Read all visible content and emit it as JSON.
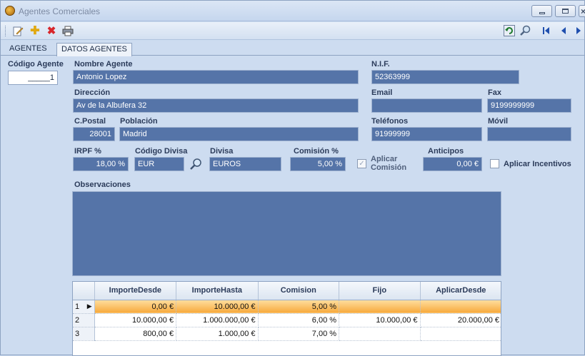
{
  "window": {
    "title": "Agentes Comerciales"
  },
  "tabs": [
    {
      "label": "AGENTES"
    },
    {
      "label": "DATOS AGENTES"
    }
  ],
  "form": {
    "codigo_agente": {
      "label": "Código Agente",
      "value": "_____1"
    },
    "nombre_agente": {
      "label": "Nombre Agente",
      "value": "Antonio Lopez"
    },
    "nif": {
      "label": "N.I.F.",
      "value": "52363999"
    },
    "direccion": {
      "label": "Dirección",
      "value": "Av de la Albufera 32"
    },
    "email": {
      "label": "Email",
      "value": ""
    },
    "fax": {
      "label": "Fax",
      "value": "9199999999"
    },
    "cpostal": {
      "label": "C.Postal",
      "value": "28001"
    },
    "poblacion": {
      "label": "Población",
      "value": "Madrid"
    },
    "telefonos": {
      "label": "Teléfonos",
      "value": "91999999"
    },
    "movil": {
      "label": "Móvil",
      "value": ""
    },
    "irpf": {
      "label": "IRPF %",
      "value": "18,00 %"
    },
    "codigo_divisa": {
      "label": "Código Divisa",
      "value": "EUR"
    },
    "divisa": {
      "label": "Divisa",
      "value": "EUROS"
    },
    "comision": {
      "label": "Comisión %",
      "value": "5,00 %"
    },
    "aplicar_comision": {
      "label_line1": "Aplicar",
      "label_line2": "Comisión",
      "checked": true
    },
    "anticipos": {
      "label": "Anticipos",
      "value": "0,00 €"
    },
    "aplicar_incentivos": {
      "label": "Aplicar Incentivos",
      "checked": false
    },
    "observaciones": {
      "label": "Observaciones",
      "value": ""
    }
  },
  "grid": {
    "columns": [
      "ImporteDesde",
      "ImporteHasta",
      "Comision",
      "Fijo",
      "AplicarDesde"
    ],
    "rows": [
      {
        "num": "1",
        "cells": [
          "0,00 €",
          "10.000,00 €",
          "5,00 %",
          "",
          ""
        ]
      },
      {
        "num": "2",
        "cells": [
          "10.000,00 €",
          "1.000.000,00 €",
          "6,00 %",
          "10.000,00 €",
          "20.000,00 €"
        ]
      },
      {
        "num": "3",
        "cells": [
          "800,00 €",
          "1.000,00 €",
          "7,00 %",
          "",
          ""
        ]
      }
    ]
  },
  "colors": {
    "field_bg": "#5574a8",
    "selected_row": "#f7a93b",
    "window_bg": "#cddcf0"
  },
  "icons": {
    "toolbar": [
      "edit-icon",
      "add-icon",
      "delete-icon",
      "print-icon",
      "refresh-icon",
      "search-icon",
      "first-record-icon",
      "previous-record-icon",
      "next-record-icon"
    ]
  }
}
